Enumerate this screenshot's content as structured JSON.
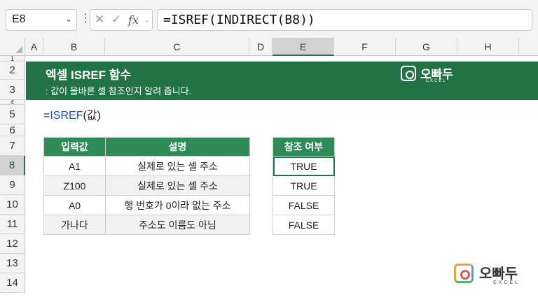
{
  "formula_bar": {
    "name_box": "E8",
    "formula": "=ISREF(INDIRECT(B8))"
  },
  "columns": [
    "A",
    "B",
    "C",
    "D",
    "E",
    "F",
    "G",
    "H"
  ],
  "rows": [
    "1",
    "2",
    "3",
    "4",
    "5",
    "6",
    "7",
    "8",
    "9",
    "10",
    "11",
    "12",
    "13",
    "14"
  ],
  "selected_column": "E",
  "selected_row": "8",
  "banner": {
    "title": "엑셀 ISREF 함수",
    "subtitle": ": 값이 올바른 셀 참조인지 알려 줍니다.",
    "logo_text": "오빠두",
    "logo_sub": "EXCEL"
  },
  "syntax": {
    "prefix": "=",
    "function": "ISREF",
    "args": "(값)"
  },
  "input_table": {
    "headers": [
      "입력값",
      "설명"
    ],
    "rows": [
      [
        "A1",
        "실제로 있는 셀 주소"
      ],
      [
        "Z100",
        "실제로 있는 셀 주소"
      ],
      [
        "A0",
        "행 번호가 0이라 없는 주소"
      ],
      [
        "가나다",
        "주소도 이름도 아님"
      ]
    ]
  },
  "result_table": {
    "header": "참조 여부",
    "rows": [
      "TRUE",
      "TRUE",
      "FALSE",
      "FALSE"
    ]
  },
  "watermark": {
    "logo_text": "오빠두",
    "logo_sub": "EXCEL"
  },
  "colors": {
    "excel_green": "#217346",
    "header_green": "#2e8b57",
    "function_blue": "#1f4fd1"
  }
}
